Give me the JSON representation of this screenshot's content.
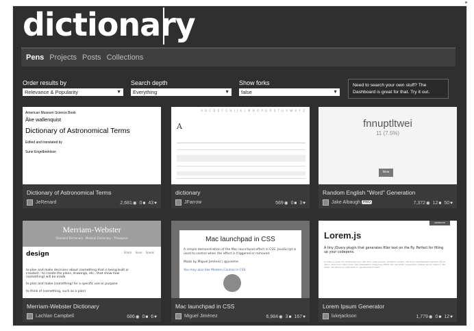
{
  "header": {
    "title": "dictionary"
  },
  "nav": {
    "items": [
      "Pens",
      "Projects",
      "Posts",
      "Collections"
    ]
  },
  "filters": [
    {
      "label": "Order results by",
      "value": "Relevance & Popularity"
    },
    {
      "label": "Search depth",
      "value": "Everything"
    },
    {
      "label": "Show forks",
      "value": "false"
    }
  ],
  "dashboard_hint": {
    "line1": "Need to search your own stuff? The",
    "line2": "Dashboard is great for that. Try it out."
  },
  "cards": [
    {
      "title": "Dictionary of Astronomical Terms",
      "author": "JeRenard",
      "views": "2,681",
      "comments": "0",
      "likes": "43",
      "thumb": {
        "small": "American Museum Science Book",
        "name": "Åke wallenquist",
        "big": "Dictionary of Astronomical Terms",
        "ed1": "Edited and translated by",
        "ed2": "Sune Engelbrektson"
      }
    },
    {
      "title": "dictionary",
      "author": "JFarrow",
      "views": "569",
      "comments": "0",
      "likes": "3",
      "thumb": {
        "alpha": "A B C D E F G H I J K L M N O P Q R S T U V W X Y Z",
        "letter": "A"
      }
    },
    {
      "title": "Random English \"Word\" Generation",
      "author": "Jake Albaugh",
      "badge": "PRO",
      "views": "7,372",
      "comments": "12",
      "likes": "50",
      "thumb": {
        "word": "fnnuptltwei",
        "pct": "11 (7.5%)",
        "button": "New"
      }
    },
    {
      "title": "Merriam-Webster Dictionary",
      "author": "Lachlan Campbell",
      "views": "686",
      "comments": "0",
      "likes": "6",
      "thumb": {
        "head": "Merriam-Webster",
        "sub": "Standard Dictionary · Medical Dictionary · Thesaurus",
        "word": "design",
        "icons": "Share Save Speak",
        "def1": "to plan and make decisions about (something that is being built or created) : to create the plans, drawings, etc., that show how (something) will be made",
        "def2": "to plan and make (something) for a specific use or purpose",
        "def3": "to think of (something, such as a plan)"
      }
    },
    {
      "title": "Mac launchpad in CSS",
      "author": "Miguel Jiménez",
      "views": "6,984",
      "comments": "3",
      "likes": "167",
      "thumb": {
        "title": "Mac launchpad in CSS",
        "l1": "A simple demonstration of the Mac launchpad effect in CSS. JavaScript is used to control when the effect is triggered or removed.",
        "l2": "Made by Miguel Jiménez | @jcoeme",
        "l3": "You may also like Modern Control in CSS"
      }
    },
    {
      "title": "Lorem Ipsum Generator",
      "author": "lukejackson",
      "views": "1,779",
      "comments": "0",
      "likes": "12",
      "thumb": {
        "bar": "GENERATE",
        "title": "Lorem.js",
        "sub": "A tiny jQuery plugin that generates filler text on the fly. Perfect for filling up your codepens.",
        "txt": "In nulla eu aute non dolore laborum, elit, dolor aute veniam, proident, veniam, nisi dolor reprehenderit pariatur. Et ea ipsum duis irure culpa lorem. Sed exercitation magna ea officia elit, nisi amet consectetur. Aliquip sed ex ullamco. Elit amet, nisi labore ex nulla dolor in reprehenderit mollit."
      }
    }
  ]
}
